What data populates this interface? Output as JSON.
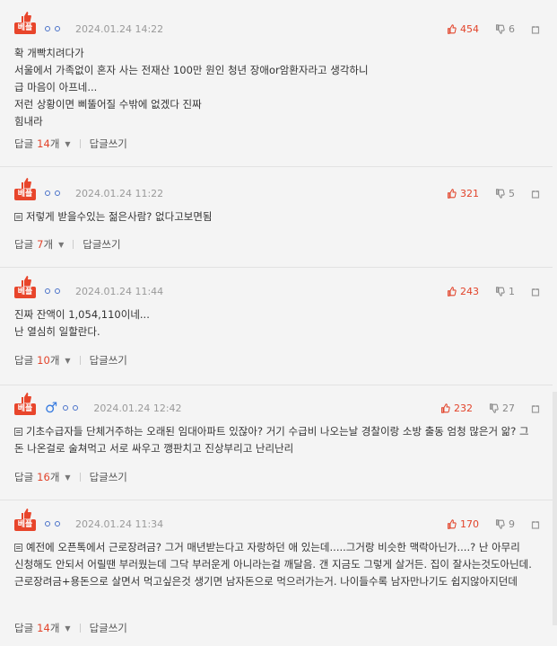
{
  "labels": {
    "best": "베플",
    "reply_prefix": "답글",
    "reply_unit": "개",
    "write_reply": "답글쓰기"
  },
  "comments": [
    {
      "date": "2024.01.24 14:22",
      "up": "454",
      "down": "6",
      "male": false,
      "memo": false,
      "text": "확 개빡치려다가\n서울에서 가족없이 혼자 사는 전재산 100만 원인 청년 장애or암환자라고 생각하니\n급 마음이 아프네...\n저런 상황이면 삐뚤어질 수밖에 없겠다 진짜\n힘내라",
      "replies": "14"
    },
    {
      "date": "2024.01.24 11:22",
      "up": "321",
      "down": "5",
      "male": false,
      "memo": true,
      "text": "저렇게 받을수있는 젊은사람? 없다고보면됨",
      "replies": "7"
    },
    {
      "date": "2024.01.24 11:44",
      "up": "243",
      "down": "1",
      "male": false,
      "memo": false,
      "text": "진짜 잔액이 1,054,110이네...\n난 열심히 일할란다.",
      "replies": "10"
    },
    {
      "date": "2024.01.24 12:42",
      "up": "232",
      "down": "27",
      "male": true,
      "memo": true,
      "text": "기초수급자들 단체거주하는 오래된 임대아파트 있잖아? 거기 수급비 나오는날 경찰이랑 소방 출동 엄청 많은거 앎? 그 돈 나온걸로 술쳐먹고 서로 싸우고 깽판치고 진상부리고 난리난리",
      "replies": "16"
    },
    {
      "date": "2024.01.24 11:34",
      "up": "170",
      "down": "9",
      "male": false,
      "memo": true,
      "text": "예전에 오픈톡에서 근로장려금? 그거 매년받는다고 자랑하던 애 있는데.....그거랑 비슷한 맥락아닌가....? 난 아무리 신청해도 안되서 어릴땐 부러웠는데 그닥 부러운게 아니라는걸 깨달음. 갠 지금도 그렇게 살거든. 집이 잘사는것도아닌데. 근로장려금+용돈으로 살면서 먹고싶은것 생기면 남자돈으로 먹으러가는거. 나이들수록 남자만나기도 쉽지않아지던데",
      "replies": "14"
    }
  ]
}
